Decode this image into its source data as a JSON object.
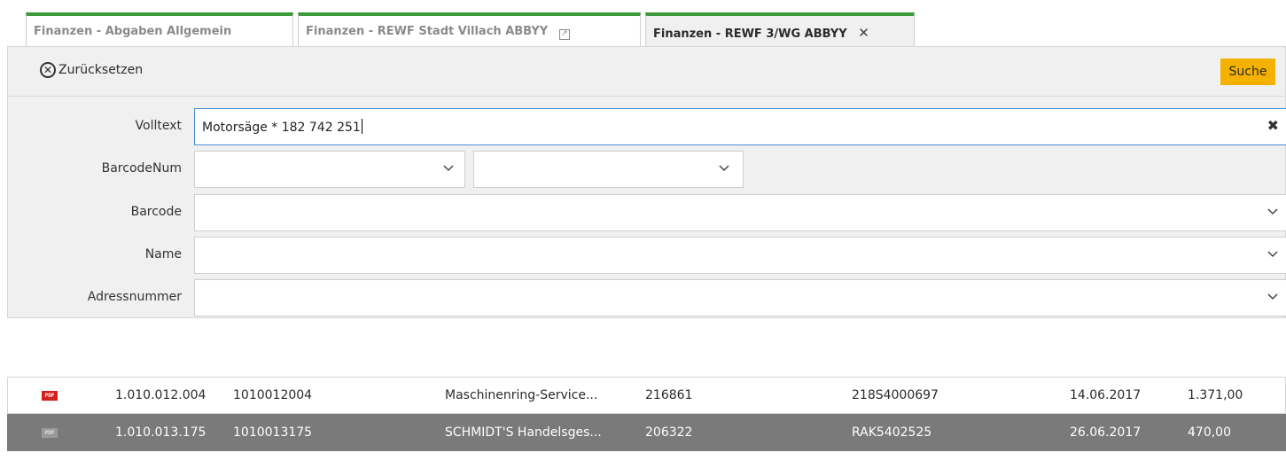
{
  "tabs": [
    {
      "label": "Finanzen - Abgaben Allgemein",
      "active": false
    },
    {
      "label": "Finanzen - REWF Stadt Villach ABBYY",
      "active": false
    },
    {
      "label": "Finanzen - REWF 3/WG ABBYY",
      "active": true
    }
  ],
  "toolbar": {
    "reset_label": "Zurücksetzen",
    "search_label": "Suche"
  },
  "form": {
    "volltext": {
      "label": "Volltext",
      "value": "Motorsäge * 182 742 251"
    },
    "barcodenum": {
      "label": "BarcodeNum",
      "value1": "",
      "value2": ""
    },
    "barcode": {
      "label": "Barcode",
      "value": ""
    },
    "name": {
      "label": "Name",
      "value": ""
    },
    "adressnummer": {
      "label": "Adressnummer",
      "value": ""
    }
  },
  "results": [
    {
      "icon": "pdf-icon",
      "icon_text": "PDF",
      "nr": "1.010.012.004",
      "id": "1010012004",
      "name": "Maschinenring-Service...",
      "code": "216861",
      "ref": "218S4000697",
      "date": "14.06.2017",
      "amount": "1.371,00",
      "selected": false
    },
    {
      "icon": "pdf-icon",
      "icon_text": "PDF",
      "nr": "1.010.013.175",
      "id": "1010013175",
      "name": "SCHMIDT'S Handelsges...",
      "code": "206322",
      "ref": "RAK5402525",
      "date": "26.06.2017",
      "amount": "470,00",
      "selected": true
    }
  ],
  "colors": {
    "accent_green": "#3c9a3c",
    "search_button": "#f5b100",
    "selected_row": "#7a7a7a",
    "focus_border": "#4a90d9"
  }
}
